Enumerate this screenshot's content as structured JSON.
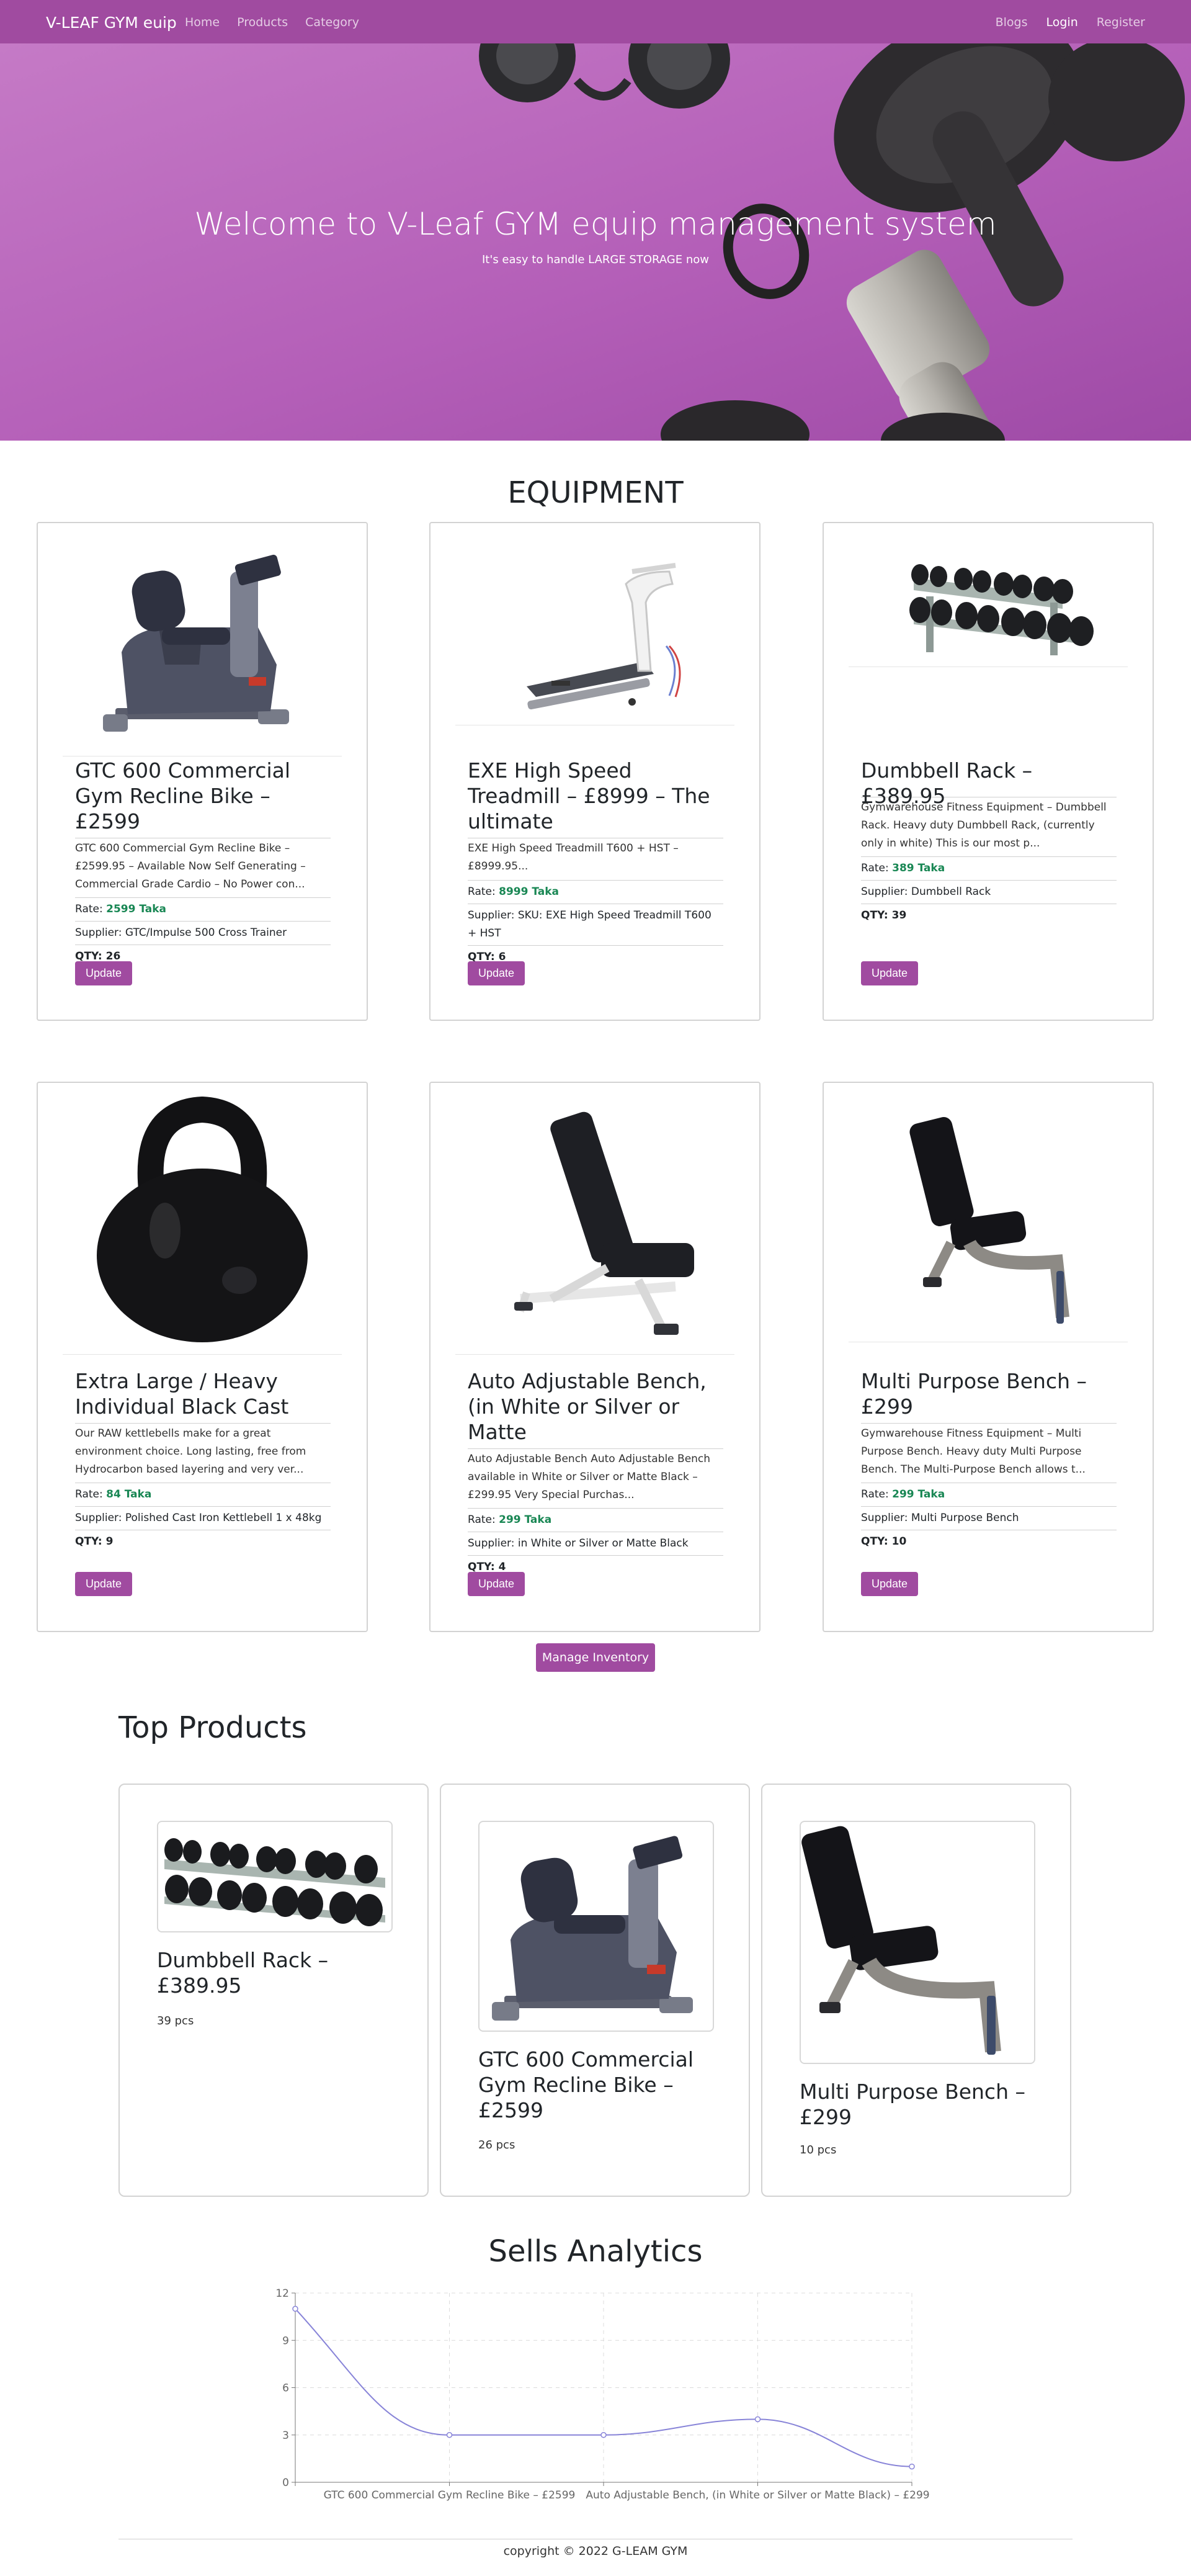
{
  "navbar": {
    "brand": "V-LEAF GYM euip",
    "left_links": [
      "Home",
      "Products",
      "Category"
    ],
    "right_links": [
      "Blogs",
      "Login",
      "Register"
    ]
  },
  "hero": {
    "title": "Welcome to V-Leaf GYM equip management system",
    "subtitle": "It's easy to handle LARGE STORAGE now"
  },
  "equipment": {
    "title": "EQUIPMENT",
    "rate_prefix": "Rate: ",
    "supplier_prefix": "Supplier: ",
    "qty_prefix": "QTY: ",
    "update_label": "Update",
    "items": [
      {
        "title": "GTC 600 Commercial Gym Recline Bike – £2599",
        "desc": "GTC 600 Commercial Gym Recline Bike – £2599.95 – Available Now Self Generating – Commercial Grade Cardio – No Power con...",
        "rate": "2599 Taka",
        "supplier": "GTC/Impulse 500 Cross Trainer",
        "qty": "26",
        "icon": "recline-bike-image"
      },
      {
        "title": "EXE High Speed Treadmill – £8999 – The ultimate",
        "desc": "EXE High Speed Treadmill T600 + HST – £8999.95...",
        "rate": "8999 Taka",
        "supplier": "SKU: EXE High Speed Treadmill T600 + HST",
        "qty": "6",
        "icon": "treadmill-image"
      },
      {
        "title": "Dumbbell Rack – £389.95",
        "desc": "Gymwarehouse Fitness Equipment – Dumbbell Rack. Heavy duty Dumbbell Rack, (currently only in white) This is our most p...",
        "rate": "389 Taka",
        "supplier": "Dumbbell Rack",
        "qty": "39",
        "icon": "dumbbell-rack-image"
      },
      {
        "title": "Extra Large / Heavy Individual Black Cast",
        "desc": "Our RAW kettlebells make for a great environment choice. Long lasting, free from Hydrocarbon based layering and very ver...",
        "rate": "84 Taka",
        "supplier": "Polished Cast Iron Kettlebell 1 x 48kg",
        "qty": "9",
        "icon": "kettlebell-image"
      },
      {
        "title": "Auto Adjustable Bench, (in White or Silver or Matte",
        "desc": "Auto Adjustable Bench Auto Adjustable Bench available in White or Silver or Matte Black – £299.95 Very Special Purchas...",
        "rate": "299 Taka",
        "supplier": "in White or Silver or Matte Black",
        "qty": "4",
        "icon": "adjustable-bench-image"
      },
      {
        "title": "Multi Purpose Bench – £299",
        "desc": "Gymwarehouse Fitness Equipment – Multi Purpose Bench. Heavy duty Multi Purpose Bench. The Multi-Purpose Bench allows t...",
        "rate": "299 Taka",
        "supplier": "Multi Purpose Bench",
        "qty": "10",
        "icon": "multi-purpose-bench-image"
      }
    ],
    "manage_label": "Manage Inventory"
  },
  "top_products": {
    "title": "Top Products",
    "items": [
      {
        "name": "Dumbbell Rack – £389.95",
        "qty": "39 pcs"
      },
      {
        "name": "GTC 600 Commercial Gym Recline Bike – £2599",
        "qty": "26 pcs"
      },
      {
        "name": "Multi Purpose Bench – £299",
        "qty": "10 pcs"
      }
    ]
  },
  "analytics": {
    "title": "Sells Analytics"
  },
  "chart_data": {
    "type": "line",
    "categories": [
      "GTC 600 Commercial Gym Recline Bike – £2599",
      "EXE High Speed Treadmill – £8999 – The ultimate",
      "Dumbbell Rack – £389.95",
      "Auto Adjustable Bench, (in White or Silver or Matte Black) – £299",
      "Multi Purpose Bench – £299"
    ],
    "visible_tick_labels": [
      "GTC 600 Commercial Gym Recline Bike – £2599",
      "Auto Adjustable Bench, (in White or Silver or Matte Black) – £299"
    ],
    "values": [
      11,
      3,
      3,
      4,
      1
    ],
    "yticks": [
      0,
      3,
      6,
      9,
      12
    ],
    "ylim": [
      0,
      12
    ],
    "grid": true,
    "color": "#8884d8"
  },
  "footer": {
    "text": "copyright © 2022 G-LEAM GYM"
  }
}
